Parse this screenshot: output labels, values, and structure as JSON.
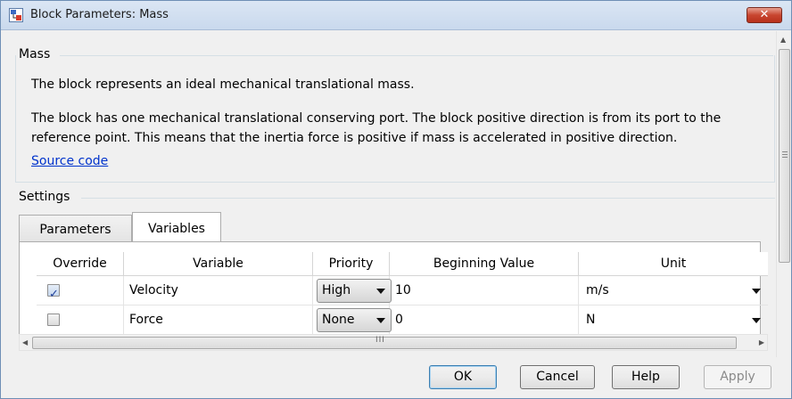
{
  "window": {
    "title": "Block Parameters: Mass",
    "close_label": "✕"
  },
  "description_group": {
    "legend": "Mass",
    "line1": "The block represents an ideal mechanical translational mass.",
    "line2": "The block has one mechanical translational conserving port. The block positive direction is from its port to the",
    "line3": "reference point. This means that the inertia force is positive if mass is accelerated in positive direction.",
    "link": "Source code"
  },
  "settings": {
    "legend": "Settings",
    "tabs": [
      {
        "label": "Parameters",
        "active": false
      },
      {
        "label": "Variables",
        "active": true
      }
    ]
  },
  "table": {
    "headers": [
      "Override",
      "Variable",
      "Priority",
      "Beginning Value",
      "Unit"
    ],
    "rows": [
      {
        "override": true,
        "variable": "Velocity",
        "priority": "High",
        "value": "10",
        "unit": "m/s"
      },
      {
        "override": false,
        "variable": "Force",
        "priority": "None",
        "value": "0",
        "unit": "N"
      }
    ]
  },
  "scroll_glyphs": {
    "grip": "III",
    "left": "◀",
    "right": "▶",
    "up": "▲",
    "down": "▼"
  },
  "buttons": {
    "ok": "OK",
    "cancel": "Cancel",
    "help": "Help",
    "apply": "Apply"
  },
  "colors": {
    "link": "#0033cc",
    "close_button": "#c8452f",
    "titlebar": "#c9d9ed"
  }
}
